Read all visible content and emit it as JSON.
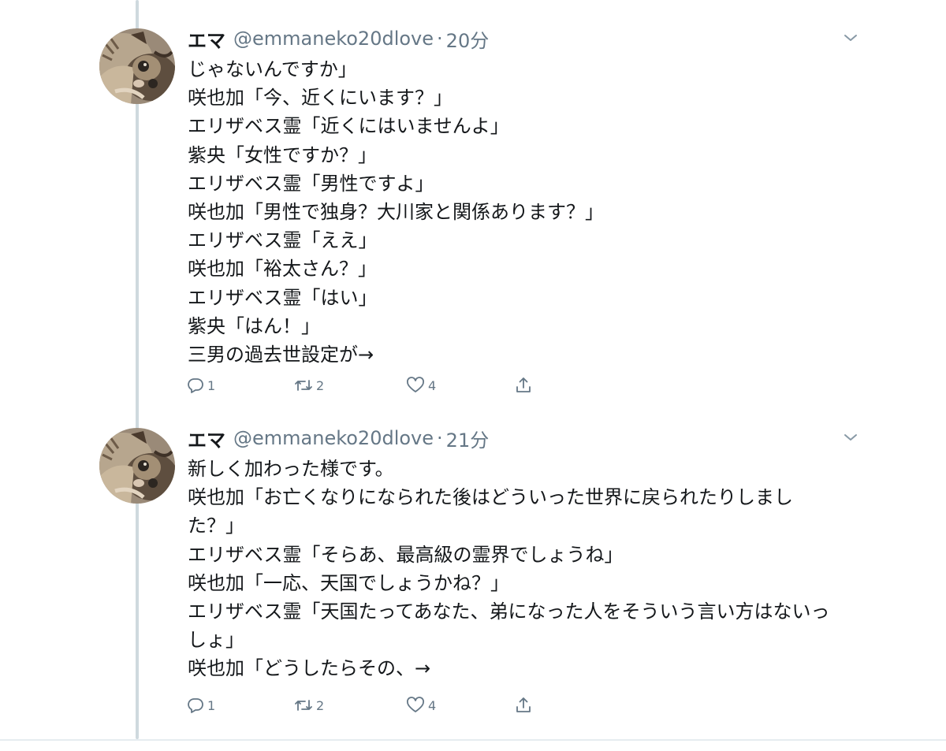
{
  "tweets": [
    {
      "display_name": "エマ",
      "handle": "@emmaneko20dlove",
      "separator": "·",
      "time": "20分",
      "lines": [
        "じゃないんですか」",
        "咲也加「今、近くにいます？」",
        "エリザベス霊「近くにはいませんよ」",
        "紫央「女性ですか？」",
        "エリザベス霊「男性ですよ」",
        "咲也加「男性で独身？大川家と関係あります？」",
        "エリザベス霊「ええ」",
        "咲也加「裕太さん？」",
        "エリザベス霊「はい」",
        "紫央「はん！」",
        "三男の過去世設定が→"
      ],
      "actions": {
        "replies": "1",
        "retweets": "2",
        "likes": "4"
      },
      "icons": {
        "reply": "reply-icon",
        "retweet": "retweet-icon",
        "like": "heart-icon",
        "share": "share-icon",
        "menu": "chevron-down-icon"
      }
    },
    {
      "display_name": "エマ",
      "handle": "@emmaneko20dlove",
      "separator": "·",
      "time": "21分",
      "lines": [
        "新しく加わった様です。",
        "咲也加「お亡くなりになられた後はどういった世界に戻られたりしまし",
        "た？」",
        "エリザベス霊「そらあ、最高級の霊界でしょうね」",
        "咲也加「一応、天国でしょうかね？」",
        "エリザベス霊「天国たってあなた、弟になった人をそういう言い方はないっ",
        "しょ」",
        "咲也加「どうしたらその、→"
      ],
      "actions": {
        "replies": "1",
        "retweets": "2",
        "likes": "4"
      },
      "icons": {
        "reply": "reply-icon",
        "retweet": "retweet-icon",
        "like": "heart-icon",
        "share": "share-icon",
        "menu": "chevron-down-icon"
      }
    }
  ],
  "colors": {
    "text": "#14171a",
    "secondary": "#657786",
    "thread_line": "#cfd9de",
    "divider": "#e6ecf0"
  }
}
